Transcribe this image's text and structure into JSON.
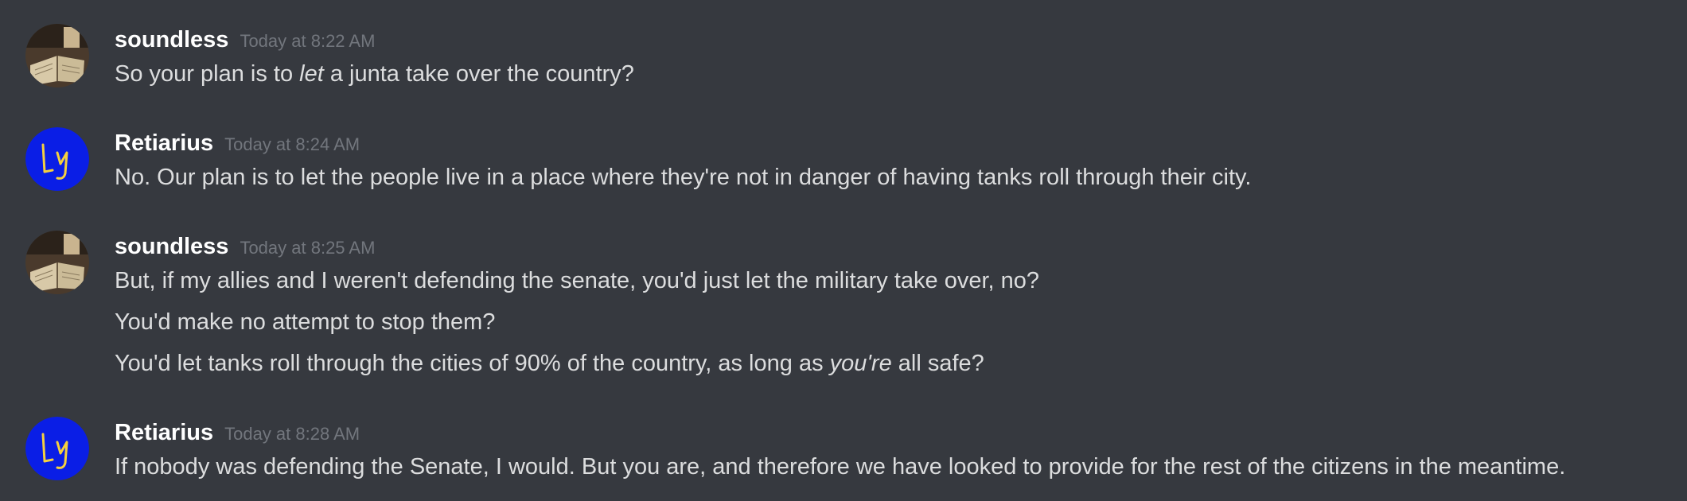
{
  "colors": {
    "background": "#36393f",
    "username": "#ffffff",
    "timestamp": "#72767d",
    "message_text": "#dcddde",
    "retiarius_avatar_bg": "#0a1ee6",
    "retiarius_avatar_glyph": "#f4d03f"
  },
  "messages": [
    {
      "author": "soundless",
      "avatar_icon": "open-book-photo-avatar",
      "timestamp": "Today at 8:22 AM",
      "lines": [
        {
          "before": "So your plan is to ",
          "italic": "let",
          "after": " a junta take over the country?"
        }
      ]
    },
    {
      "author": "Retiarius",
      "avatar_icon": "handwritten-ly-avatar",
      "timestamp": "Today at 8:24 AM",
      "lines": [
        {
          "before": "No. Our plan is to let the people live in a place where they're not in danger of having tanks roll through their city.",
          "italic": "",
          "after": ""
        }
      ]
    },
    {
      "author": "soundless",
      "avatar_icon": "open-book-photo-avatar",
      "timestamp": "Today at 8:25 AM",
      "lines": [
        {
          "before": "But, if my allies and I weren't defending the senate, you'd just let the military take over, no?",
          "italic": "",
          "after": ""
        },
        {
          "before": "You'd make no attempt to stop them?",
          "italic": "",
          "after": ""
        },
        {
          "before": "You'd let tanks roll through the cities of 90% of the country, as long as ",
          "italic": "you're",
          "after": " all safe?"
        }
      ]
    },
    {
      "author": "Retiarius",
      "avatar_icon": "handwritten-ly-avatar",
      "timestamp": "Today at 8:28 AM",
      "lines": [
        {
          "before": "If nobody was defending the Senate, I would. But you are, and therefore we have looked to provide for the rest of the citizens in the meantime.",
          "italic": "",
          "after": ""
        }
      ]
    }
  ]
}
